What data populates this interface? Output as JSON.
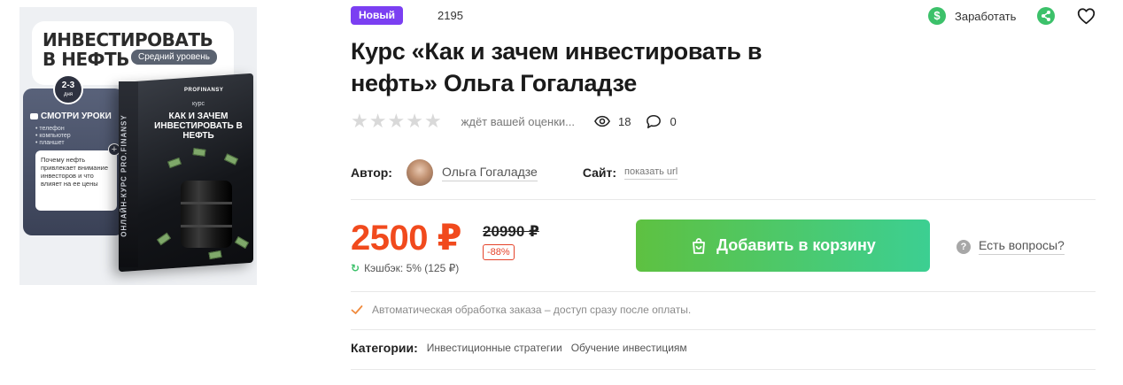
{
  "product_image": {
    "title": "ИНВЕСТИРОВАТЬ В НЕФТЬ",
    "level": "Средний уровень",
    "days": "2-3",
    "days_unit": "дня",
    "watch_label": "СМОТРИ УРОКИ",
    "devices": [
      "телефон",
      "компьютер",
      "планшет"
    ],
    "quote": "Почему нефть привлекает внимание инвесторов и что влияет на ее цены",
    "box_brand": "PROFINANSY",
    "box_course": "курс",
    "box_title": "КАК И ЗАЧЕМ ИНВЕСТИРОВАТЬ В НЕФТЬ",
    "box_side": "ОНЛАЙН-КУРС PRO.FINANSY"
  },
  "badge": {
    "label": "Новый",
    "color": "#7b3ff2"
  },
  "product_id": "2195",
  "header_actions": {
    "earn_label": "Заработать",
    "earn_icon": "dollar-icon",
    "share_icon": "share-icon",
    "favorite_icon": "heart-icon"
  },
  "title": "Курс «Как и зачем инвестировать в нефть» Ольга Гогаладзе",
  "rating": {
    "stars_filled": 0,
    "stars_total": 5,
    "text": "ждёт вашей оценки...",
    "views": "18",
    "comments": "0"
  },
  "author": {
    "label": "Автор:",
    "name": "Ольга Гогаладзе",
    "site_label": "Сайт:",
    "site_link": "показать url"
  },
  "pricing": {
    "price": "2500 ₽",
    "old_price": "20990 ₽",
    "discount": "-88%",
    "cashback": "Кэшбэк: 5% (125 ₽)",
    "accent_color": "#f14a1d"
  },
  "cart": {
    "label": "Добавить в корзину"
  },
  "questions": {
    "label": "Есть вопросы?"
  },
  "auto_notice": "Автоматическая обработка заказа – доступ сразу после оплаты.",
  "categories": {
    "label": "Категории:",
    "items": [
      "Инвестиционные стратегии",
      "Обучение инвестициям"
    ]
  }
}
